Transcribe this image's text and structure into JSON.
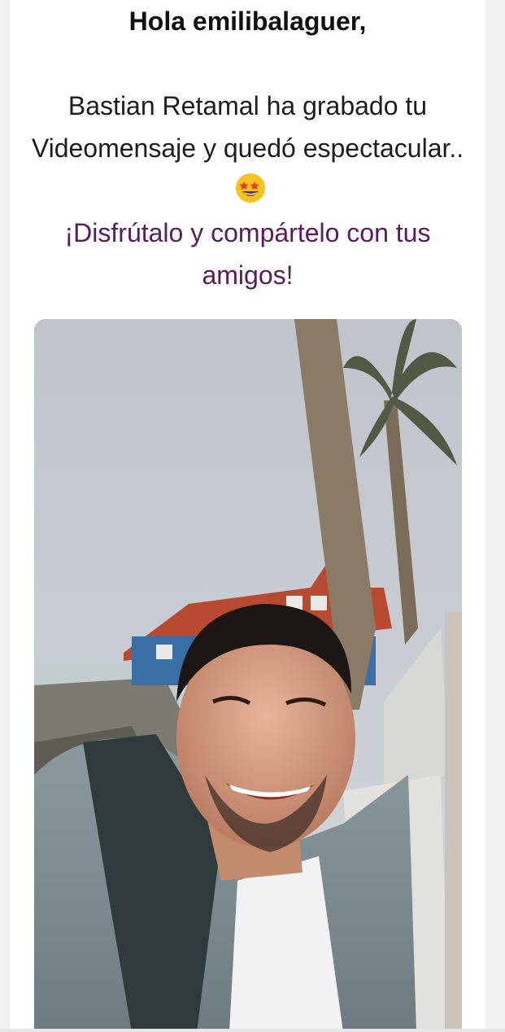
{
  "email": {
    "greeting": "Hola emilibalaguer,",
    "message_line": "Bastian Retamal ha grabado tu Videomensaje y quedó espectacular..",
    "message_emoji": "star-struck-emoji",
    "cta_line": "¡Disfrútalo y compártelo con tus amigos!",
    "cta_color": "#5b1a5e"
  },
  "video": {
    "thumbnail_icon": "video-thumbnail-selfie"
  }
}
